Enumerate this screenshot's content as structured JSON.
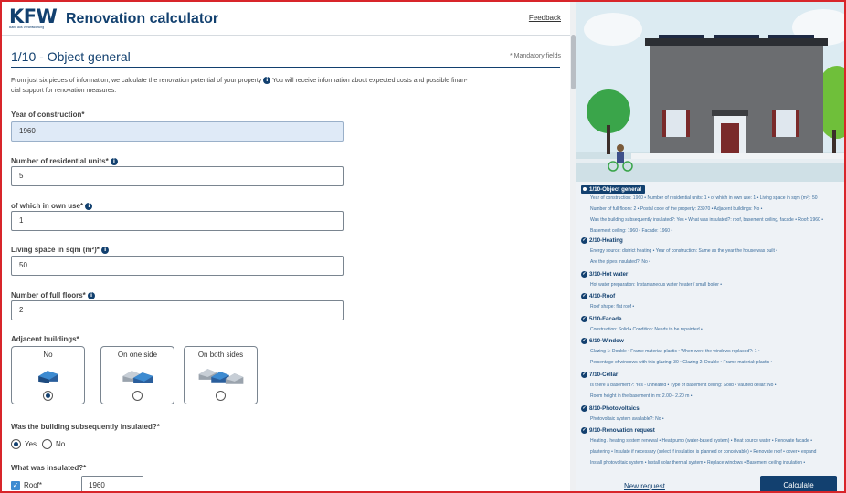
{
  "header": {
    "logo_text": "KFW",
    "logo_subtext": "Bank aus Verantwortung",
    "app_title": "Renovation calculator",
    "feedback_label": "Feedback"
  },
  "step": {
    "title": "1/10 - Object general",
    "mandatory_note": "* Mandatory fields",
    "intro_part1": "From just six pieces of information, we calculate the renovation potential of your property",
    "intro_part2": "You will receive information about expected costs and possible finan-",
    "intro_part3": "cial support for renovation measures.",
    "info_glyph": "i"
  },
  "form": {
    "year_label": "Year of construction*",
    "year_value": "1960",
    "units_label": "Number of residential units*",
    "units_value": "5",
    "own_use_label": "of which in own use*",
    "own_use_value": "1",
    "living_space_label": "Living space in sqm (m²)*",
    "living_space_value": "50",
    "floors_label": "Number of full floors*",
    "floors_value": "2",
    "adjacent_label": "Adjacent buildings*",
    "adjacent_options": [
      "No",
      "On one side",
      "On both sides"
    ],
    "adjacent_selected": "No",
    "insulated_question": "Was the building subsequently insulated?*",
    "insulated_yes": "Yes",
    "insulated_no": "No",
    "insulated_selected": "Yes",
    "what_insulated_label": "What was insulated?*",
    "roof_label": "Roof*",
    "roof_checked": true,
    "roof_year": "1960"
  },
  "summary": {
    "sections": [
      {
        "title": "1/10-Object general",
        "current": true,
        "lines": [
          "Year of construction: 1960 • Number of residential units: 1 • of which in own use: 1 • Living space in sqm (m²): 50",
          "Number of full floors: 2 • Postal code of the property: 23970 • Adjacent buildings: No •",
          "Was the building subsequently insulated?: Yes • What was insulated?: roof, basement ceiling, facade • Roof: 1960 •",
          "Basement ceiling: 1960 • Facade: 1960 •"
        ]
      },
      {
        "title": "2/10-Heating",
        "current": false,
        "lines": [
          "Energy source: district heating • Year of construction: Same as the year the house was built •",
          "Are the pipes insulated?: No •"
        ]
      },
      {
        "title": "3/10-Hot water",
        "current": false,
        "lines": [
          "Hot water preparation: Instantaneous water heater / small boiler •"
        ]
      },
      {
        "title": "4/10-Roof",
        "current": false,
        "lines": [
          "Roof shape: flat roof •"
        ]
      },
      {
        "title": "5/10-Facade",
        "current": false,
        "lines": [
          "Construction: Solid • Condition: Needs to be repainted •"
        ]
      },
      {
        "title": "6/10-Window",
        "current": false,
        "lines": [
          "Glazing 1: Double • Frame material: plastic • When were the windows replaced?: 1 •",
          "Percentage of windows with this glazing: 30 • Glazing 2: Double • Frame material: plastic •"
        ]
      },
      {
        "title": "7/10-Cellar",
        "current": false,
        "lines": [
          "Is there a basement?: Yes - unheated • Type of basement ceiling: Solid • Vaulted cellar: No •",
          "Room height in the basement in m: 2.00 - 2.20 m •"
        ]
      },
      {
        "title": "8/10-Photovoltaics",
        "current": false,
        "lines": [
          "Photovoltaic system available?: No •"
        ]
      },
      {
        "title": "9/10-Renovation request",
        "current": false,
        "lines": [
          "Heating / heating system renewal • Heat pump (water-based system) • Heat source water • Renovate facade •",
          "plastering • Insulate if necessary (select if insulation is planned or conceivable) • Renovate roof • cover • expand",
          "Install photovoltaic system • Install solar thermal system • Replace windows • Basement ceiling insulation •"
        ]
      }
    ],
    "new_request_label": "New request",
    "calculate_label": "Calculate",
    "check_glyph": "✓"
  },
  "colors": {
    "brand": "#12406f",
    "accent": "#3d8bd1",
    "frame": "#d8252a"
  }
}
